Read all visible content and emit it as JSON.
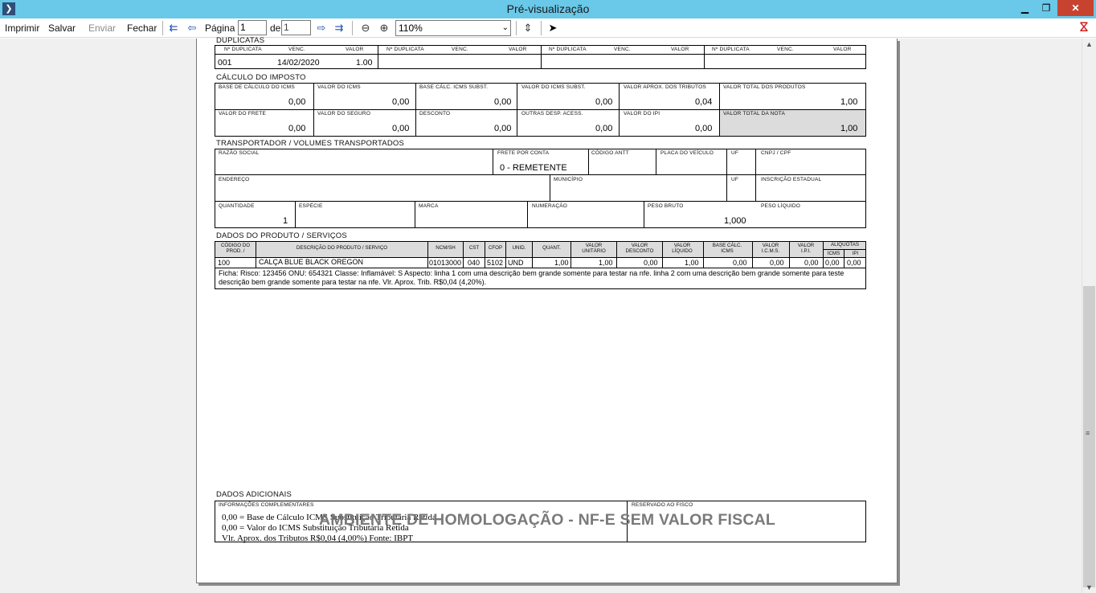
{
  "window": {
    "title": "Pré-visualização",
    "app_icon": "arrow-icon",
    "min": "▁",
    "max": "❐",
    "close": "✕"
  },
  "toolbar": {
    "imprimir": "Imprimir",
    "salvar": "Salvar",
    "enviar": "Enviar",
    "fechar": "Fechar",
    "pagina_label": "Página",
    "pagina_value": "1",
    "de_label": "de",
    "total_pages": "1",
    "zoom": "110%"
  },
  "danfe": {
    "duplicatas": {
      "header": "DUPLICATAS",
      "col_num": "Nº DUPLICATA",
      "col_venc": "VENC.",
      "col_valor": "VALOR",
      "num": "001",
      "venc": "14/02/2020",
      "valor": "1.00"
    },
    "imposto": {
      "title": "CÁLCULO DO IMPOSTO",
      "base_icms_l": "BASE DE CÁLCULO DO ICMS",
      "base_icms": "0,00",
      "valor_icms_l": "VALOR DO ICMS",
      "valor_icms": "0,00",
      "base_st_l": "BASE CÁLC. ICMS SUBST.",
      "base_st": "0,00",
      "valor_st_l": "VALOR DO ICMS SUBST.",
      "valor_st": "0,00",
      "aprox_l": "VALOR APROX. DOS TRIBUTOS",
      "aprox": "0,04",
      "total_prod_l": "VALOR TOTAL DOS PRODUTOS",
      "total_prod": "1,00",
      "frete_l": "VALOR DO FRETE",
      "frete": "0,00",
      "seguro_l": "VALOR DO SEGURO",
      "seguro": "0,00",
      "desconto_l": "DESCONTO",
      "desconto": "0,00",
      "outras_l": "OUTRAS DESP. ACESS.",
      "outras": "0,00",
      "ipi_l": "VALOR DO IPI",
      "ipi": "0,00",
      "total_nota_l": "VALOR TOTAL DA NOTA",
      "total_nota": "1,00"
    },
    "transp": {
      "title": "TRANSPORTADOR / VOLUMES TRANSPORTADOS",
      "razao_l": "RAZÃO SOCIAL",
      "frete_l": "FRETE POR CONTA",
      "frete": "0 - REMETENTE",
      "antt_l": "CÓDIGO ANTT",
      "placa_l": "PLACA DO VEÍCULO",
      "uf_l": "UF",
      "cnpj_l": "CNPJ / CPF",
      "endereco_l": "ENDEREÇO",
      "municipio_l": "MUNICÍPIO",
      "uf2_l": "UF",
      "ie_l": "INSCRIÇÃO ESTADUAL",
      "qtd_l": "QUANTIDADE",
      "qtd": "1",
      "especie_l": "ESPÉCIE",
      "marca_l": "MARCA",
      "numeracao_l": "NUMERAÇÃO",
      "peso_bruto_l": "PESO BRUTO",
      "peso_bruto": "1,000",
      "peso_liq_l": "PESO LÍQUIDO"
    },
    "produtos": {
      "title": "DADOS DO PRODUTO / SERVIÇOS",
      "headers": {
        "codigo": "CÓDIGO DO PROD. /",
        "descricao": "DESCRIÇÃO DO PRODUTO / SERVIÇO",
        "ncm": "NCM/SH",
        "cst": "CST",
        "cfop": "CFOP",
        "unid": "UNID.",
        "quant": "QUANT.",
        "vunit": "VALOR UNITÁRIO",
        "vdesc": "VALOR DESCONTO",
        "vliq": "VALOR LÍQUIDO",
        "bcicms": "BASE CÁLC. ICMS",
        "vicms": "VALOR I.C.M.S.",
        "vipi": "VALOR I.P.I.",
        "aliq": "ALÍQUOTAS",
        "icms": "ICMS",
        "ipi": "IPI"
      },
      "row": {
        "codigo": "100",
        "descricao": "CALÇA BLUE BLACK OREGON",
        "ncm": "01013000",
        "cst": "040",
        "cfop": "5102",
        "unid": "UND",
        "quant": "1,00",
        "vunit": "1,00",
        "vdesc": "0,00",
        "vliq": "1,00",
        "bcicms": "0,00",
        "vicms": "0,00",
        "vipi": "0,00",
        "icms": "0,00",
        "ipi": "0,00"
      },
      "ficha_line1": "Ficha:  Risco: 123456 ONU: 654321 Classe:  Inflamável: S Aspecto: linha 1 com uma descrição bem grande somente para testar na nfe. linha 2 com uma descrição bem grande somente para teste",
      "ficha_line2": "descrição bem grande somente para testar na nfe. Vlr. Aprox. Trib. R$0,04 (4,20%)."
    },
    "adicionais": {
      "title": "DADOS ADICIONAIS",
      "info_l": "INFORMAÇÕES COMPLEMENTARES",
      "fisco_l": "RESERVADO AO FISCO",
      "line1": "0,00 = Base de Cálculo ICMS Substituição Tributária Retida",
      "line2": "0,00 = Valor do ICMS Substituição Tributária Retida",
      "line3": "Vlr. Aprox. dos Tributos R$0,04 (4,00%) Fonte: IBPT",
      "watermark": "AMBIENTE DE HOMOLOGAÇÃO - NF-E SEM VALOR FISCAL"
    }
  }
}
